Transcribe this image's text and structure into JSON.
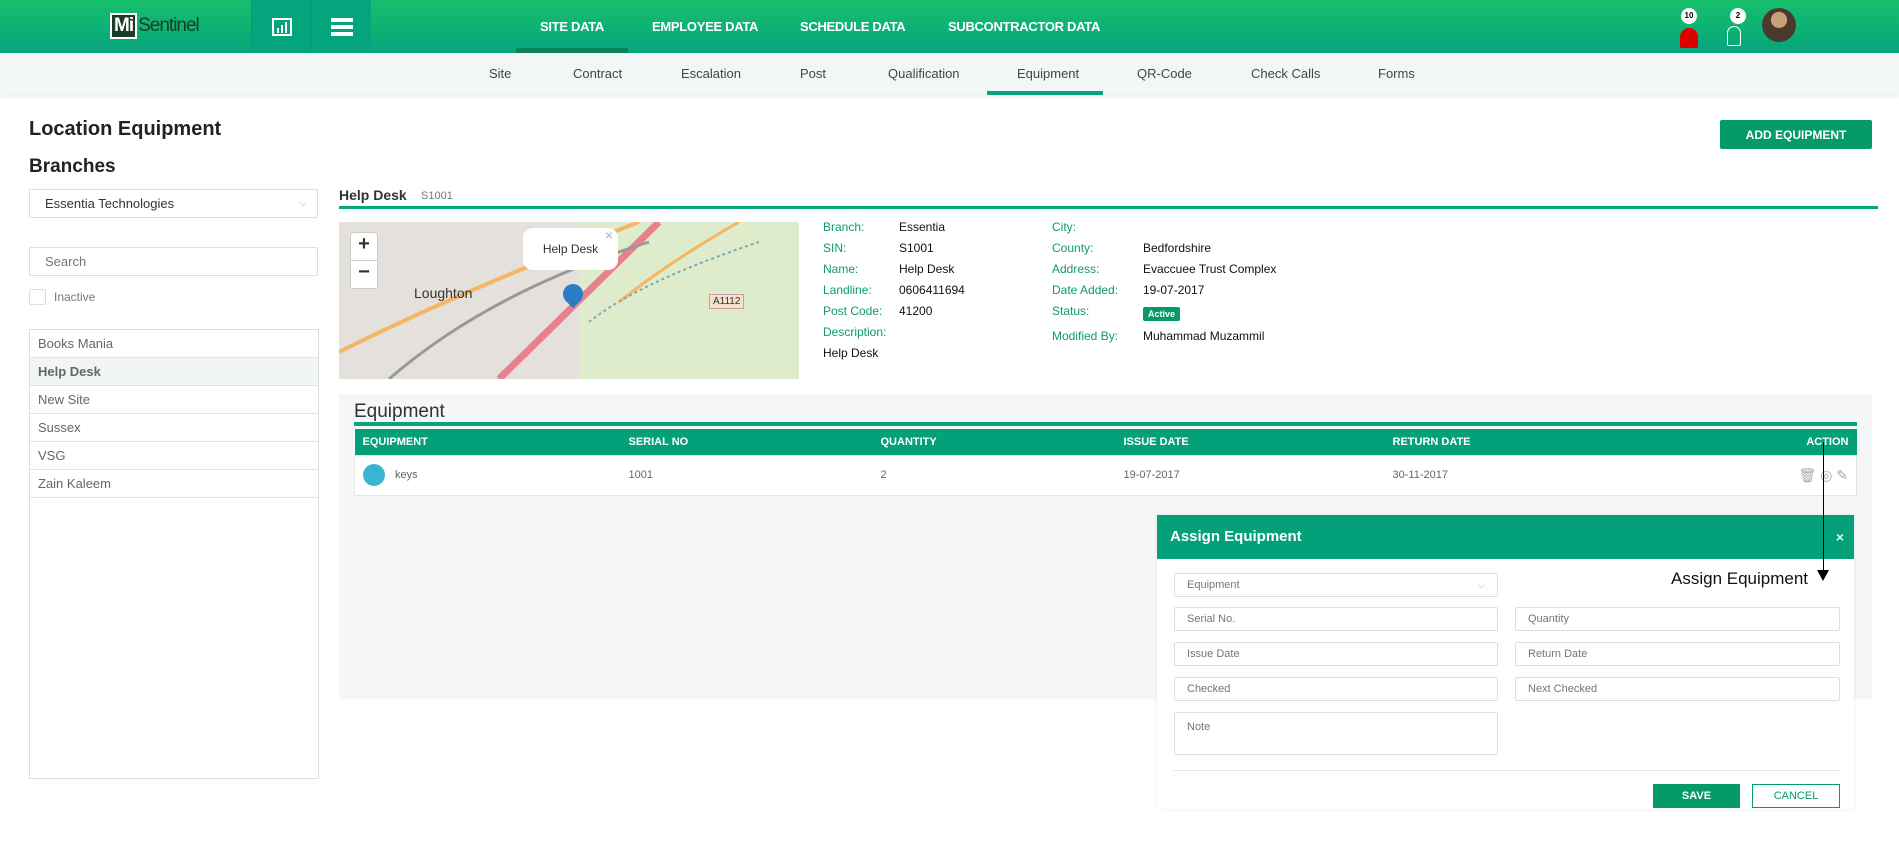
{
  "header": {
    "logo": "MiSentinel",
    "nav": [
      "SITE DATA",
      "EMPLOYEE DATA",
      "SCHEDULE DATA",
      "SUBCONTRACTOR DATA"
    ],
    "alerts_count": "10",
    "notifications_count": "2"
  },
  "subnav": [
    "Site",
    "Contract",
    "Escalation",
    "Post",
    "Qualification",
    "Equipment",
    "QR-Code",
    "Check Calls",
    "Forms"
  ],
  "page": {
    "title": "Location Equipment",
    "add_button": "ADD EQUIPMENT"
  },
  "sidebar": {
    "heading": "Branches",
    "branch_select": "Essentia Technologies",
    "search_placeholder": "Search",
    "inactive_label": "Inactive",
    "sites": [
      "Books Mania",
      "Help Desk",
      "New Site",
      "Sussex",
      "VSG",
      "Zain Kaleem"
    ],
    "selected": "Help Desk"
  },
  "site": {
    "name": "Help Desk",
    "sin_badge": "S1001",
    "map": {
      "popup": "Help Desk",
      "place": "Loughton",
      "road": "A1112",
      "zoom_in": "+",
      "zoom_out": "−"
    },
    "info_left": [
      {
        "label": "Branch:",
        "value": "Essentia"
      },
      {
        "label": "SIN:",
        "value": "S1001"
      },
      {
        "label": "Name:",
        "value": "Help Desk"
      },
      {
        "label": "Landline:",
        "value": "0606411694"
      },
      {
        "label": "Post Code:",
        "value": "41200"
      },
      {
        "label": "Description:",
        "value": ""
      }
    ],
    "description": "Help Desk",
    "info_right": [
      {
        "label": "City:",
        "value": ""
      },
      {
        "label": "County:",
        "value": "Bedfordshire"
      },
      {
        "label": "Address:",
        "value": "Evaccuee Trust Complex"
      },
      {
        "label": "Date Added:",
        "value": "19-07-2017"
      },
      {
        "label": "Status:",
        "value": "Active"
      },
      {
        "label": "Modified By:",
        "value": "Muhammad Muzammil"
      }
    ]
  },
  "equipment": {
    "heading": "Equipment",
    "columns": [
      "EQUIPMENT",
      "SERIAL NO",
      "QUANTITY",
      "ISSUE DATE",
      "RETURN DATE",
      "ACTION"
    ],
    "rows": [
      {
        "name": "keys",
        "serial": "1001",
        "quantity": "2",
        "issue": "19-07-2017",
        "return": "30-11-2017"
      }
    ]
  },
  "modal": {
    "title": "Assign Equipment",
    "close": "×",
    "equipment_select": "Equipment",
    "fields": {
      "serial": "Serial No.",
      "quantity": "Quantity",
      "issue": "Issue Date",
      "return": "Return Date",
      "checked": "Checked",
      "next_checked": "Next Checked",
      "note": "Note"
    },
    "save": "SAVE",
    "cancel": "CANCEL"
  },
  "annotation": "Assign Equipment",
  "colors": {
    "brand": "#06a57c",
    "accent": "#04a07a"
  }
}
